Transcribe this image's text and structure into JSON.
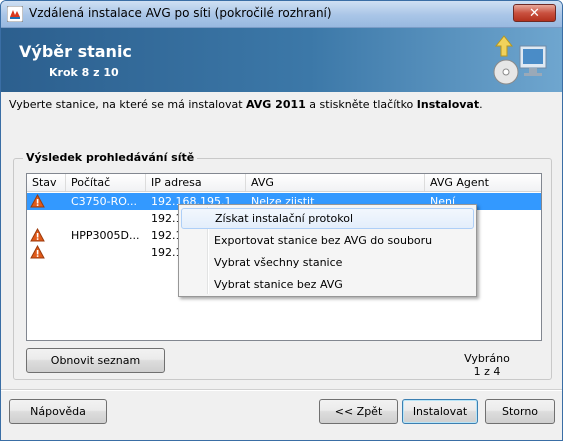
{
  "window": {
    "title": "Vzdálená instalace AVG po síti (pokročilé rozhraní)",
    "close_glyph": "✕"
  },
  "header": {
    "title": "Výběr stanic",
    "step": "Krok 8 z 10"
  },
  "instruction": {
    "part1": "Vyberte stanice, na které se má instalovat ",
    "product": "AVG 2011",
    "part2": " a stiskněte tlačítko ",
    "button_ref": "Instalovat",
    "part3": "."
  },
  "results": {
    "group_label": "Výsledek prohledávání sítě",
    "columns": [
      "Stav",
      "Počítač",
      "IP adresa",
      "AVG",
      "AVG Agent"
    ],
    "rows": [
      {
        "status_icon": "warning-icon",
        "computer": "C3750-RO...",
        "ip": "192.168.195.1",
        "avg": "Nelze zjistit",
        "agent": "Není",
        "selected": true
      },
      {
        "status_icon": "",
        "computer": "",
        "ip": "192.1",
        "avg": "",
        "agent": "",
        "selected": false
      },
      {
        "status_icon": "warning-icon",
        "computer": "HPP3005D...",
        "ip": "192.1",
        "avg": "",
        "agent": "",
        "selected": false
      },
      {
        "status_icon": "warning-icon",
        "computer": "",
        "ip": "192.1",
        "avg": "",
        "agent": "",
        "selected": false
      }
    ]
  },
  "context_menu": {
    "items": [
      "Získat instalační protokol",
      "Exportovat stanice bez AVG do souboru",
      "Vybrat všechny stanice",
      "Vybrat stanice bez AVG"
    ]
  },
  "refresh_label": "Obnovit seznam",
  "selection": {
    "label": "Vybráno",
    "count": "1 z 4"
  },
  "footer": {
    "help": "Nápověda",
    "back": "<< Zpět",
    "install": "Instalovat",
    "cancel": "Storno"
  },
  "colors": {
    "header_bg": "#2c5f8e",
    "selection": "#3399ff",
    "warning": "#e05a1a"
  }
}
